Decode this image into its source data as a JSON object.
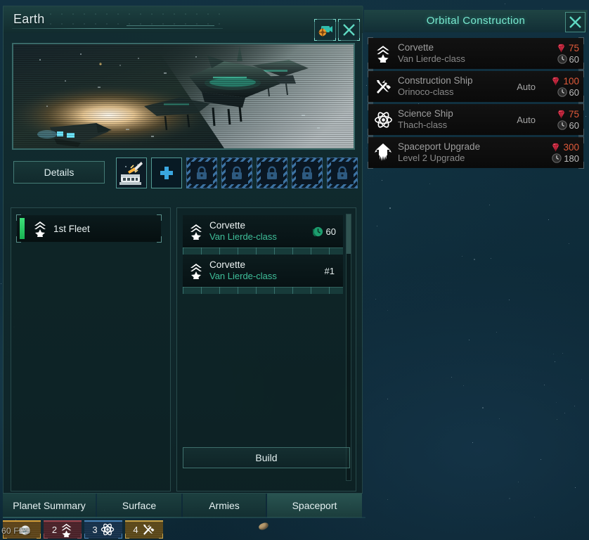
{
  "window": {
    "title": "Earth",
    "camera_icon": "camera-crosshair-icon",
    "close_icon": "close-x-icon"
  },
  "details": {
    "label": "Details"
  },
  "slots": [
    {
      "type": "building",
      "icon": "missile-launcher-icon",
      "locked": false
    },
    {
      "type": "add",
      "icon": "plus-icon",
      "locked": false
    },
    {
      "type": "locked",
      "icon": "lock-icon",
      "locked": true
    },
    {
      "type": "locked",
      "icon": "lock-icon",
      "locked": true
    },
    {
      "type": "locked",
      "icon": "lock-icon",
      "locked": true
    },
    {
      "type": "locked",
      "icon": "lock-icon",
      "locked": true
    },
    {
      "type": "locked",
      "icon": "lock-icon",
      "locked": true
    }
  ],
  "fleets": [
    {
      "name": "1st Fleet",
      "icon": "corvette-rank-icon",
      "health_bar": "#3ee07a"
    }
  ],
  "build_queue": {
    "items": [
      {
        "name": "Corvette",
        "ship_class": "Van Lierde-class",
        "icon": "corvette-rank-icon",
        "time": "60",
        "time_icon": "clock-green-icon",
        "order": ""
      },
      {
        "name": "Corvette",
        "ship_class": "Van Lierde-class",
        "icon": "corvette-rank-icon",
        "time": "",
        "time_icon": "",
        "order": "#1"
      }
    ],
    "build_label": "Build"
  },
  "orbital_construction": {
    "title": "Orbital Construction",
    "close_icon": "close-x-icon",
    "items": [
      {
        "name": "Corvette",
        "subtitle": "Van Lierde-class",
        "icon": "corvette-rank-icon",
        "auto": "",
        "minerals": "75",
        "time": "60"
      },
      {
        "name": "Construction Ship",
        "subtitle": "Orinoco-class",
        "icon": "tools-icon",
        "auto": "Auto",
        "minerals": "100",
        "time": "60"
      },
      {
        "name": "Science Ship",
        "subtitle": "Thach-class",
        "icon": "atom-icon",
        "auto": "Auto",
        "minerals": "75",
        "time": "60"
      },
      {
        "name": "Spaceport Upgrade",
        "subtitle": "Level 2 Upgrade",
        "icon": "spaceport-upgrade-icon",
        "auto": "",
        "minerals": "300",
        "time": "180"
      }
    ]
  },
  "tabs": [
    {
      "label": "Planet Summary",
      "active": false
    },
    {
      "label": "Surface",
      "active": false
    },
    {
      "label": "Armies",
      "active": false
    },
    {
      "label": "Spaceport",
      "active": true
    }
  ],
  "status_chips": [
    {
      "number": "",
      "icon": "planet-colony-icon",
      "accent": "#d9a23c"
    },
    {
      "number": "2",
      "icon": "corvette-rank-icon",
      "accent": "#a04a52"
    },
    {
      "number": "3",
      "icon": "atom-icon",
      "accent": "#4a84b8"
    },
    {
      "number": "4",
      "icon": "tools-icon",
      "accent": "#c8a44a"
    }
  ],
  "fps_counter": "60 FPS",
  "colors": {
    "accent_teal": "#79e8cf",
    "ship_class_green": "#3fbf9a",
    "minerals_red": "#e05a3a",
    "locked_blue": "#4682b9"
  }
}
